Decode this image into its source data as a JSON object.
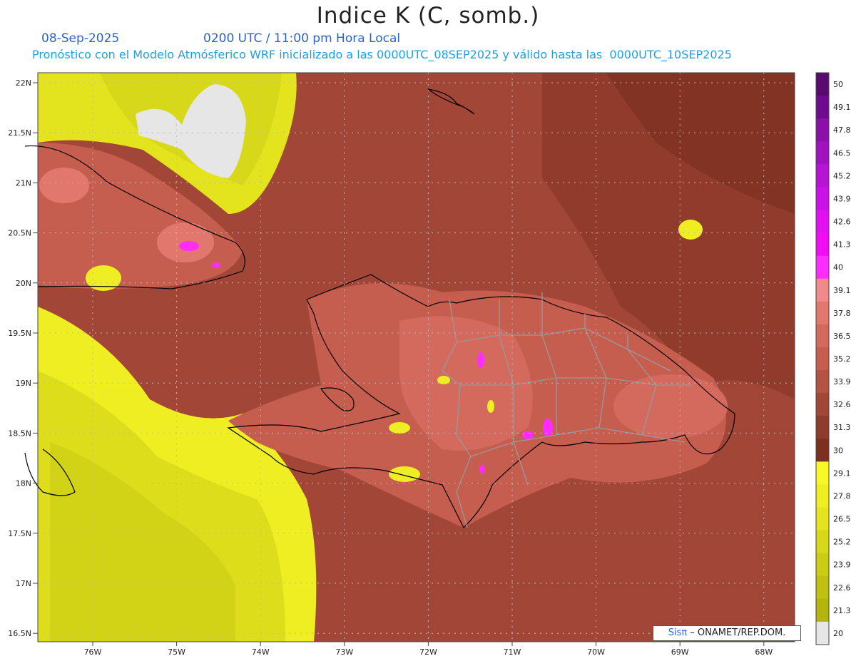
{
  "title": "Indice K (C, somb.)",
  "date": "08-Sep-2025",
  "time_label": "0200 UTC / 11:00 pm Hora Local",
  "subtitle": "Pronóstico con el Modelo Atmósferico WRF inicializado a las 0000UTC_08SEP2025 y válido hasta las  0000UTC_10SEP2025",
  "credit": {
    "brand": "Sisπ",
    "text": " – ONAMET/REP.DOM."
  },
  "lat_labels": [
    "22N",
    "21.5N",
    "21N",
    "20.5N",
    "20N",
    "19.5N",
    "19N",
    "18.5N",
    "18N",
    "17.5N",
    "17N",
    "16.5N"
  ],
  "lon_labels": [
    "76W",
    "75W",
    "74W",
    "73W",
    "72W",
    "71W",
    "70W",
    "69W",
    "68W"
  ],
  "colorbar": {
    "labels": [
      "50",
      "49.1",
      "47.8",
      "46.5",
      "45.2",
      "43.9",
      "42.6",
      "41.3",
      "40",
      "39.1",
      "37.8",
      "36.5",
      "35.2",
      "33.9",
      "32.6",
      "31.3",
      "30",
      "29.1",
      "27.8",
      "26.5",
      "25.2",
      "23.9",
      "22.6",
      "21.3",
      "20"
    ],
    "colors": [
      "#5a0a6e",
      "#6e0b8c",
      "#8a10a8",
      "#a012c0",
      "#b814d6",
      "#cc10e8",
      "#e010f0",
      "#f00cf4",
      "#ff2cff",
      "#f08a8a",
      "#e2776e",
      "#d46a5e",
      "#c65e50",
      "#b45244",
      "#a24638",
      "#8e3a2c",
      "#7e3020",
      "#f8f828",
      "#eeee22",
      "#e4e41e",
      "#d8d81a",
      "#cccc16",
      "#c0c012",
      "#b4b40e",
      "#e6e6e6"
    ]
  }
}
